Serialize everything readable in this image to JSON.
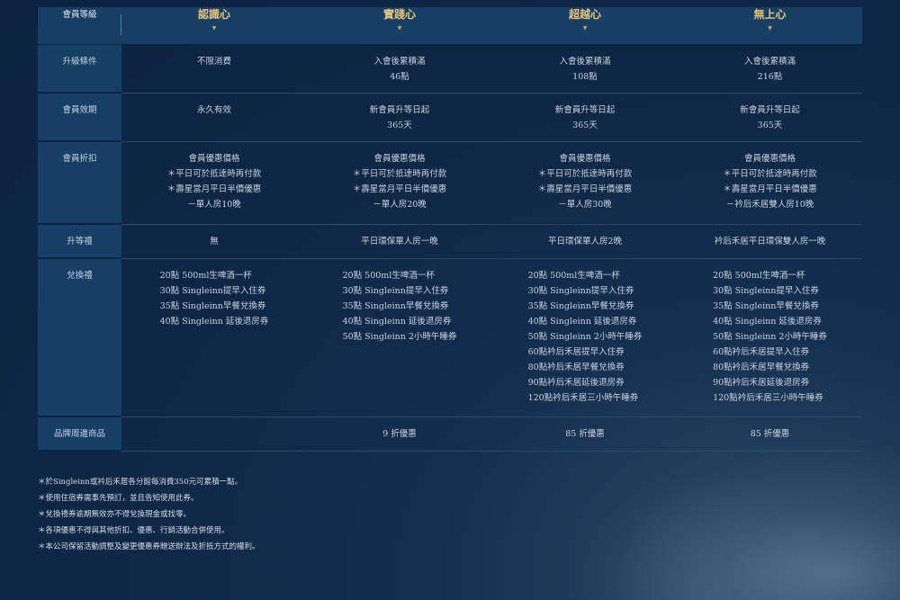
{
  "header": {
    "label": "會員等級",
    "tiers": [
      "認識心",
      "實踐心",
      "超越心",
      "無上心"
    ]
  },
  "rows": {
    "upgrade": {
      "label": "升級條件",
      "cells": [
        [
          "",
          "不限消費"
        ],
        [
          "入會後累積滿",
          "46點"
        ],
        [
          "入會後累積滿",
          "108點"
        ],
        [
          "入會後累積滿",
          "216點"
        ]
      ]
    },
    "validity": {
      "label": "會員效期",
      "cells": [
        [
          "永久有效"
        ],
        [
          "新會員升等日起",
          "365天"
        ],
        [
          "新會員升等日起",
          "365天"
        ],
        [
          "新會員升等日起",
          "365天"
        ]
      ]
    },
    "discount": {
      "label": "會員折扣",
      "cells": [
        [
          "會員優惠價格",
          "＊平日可於抵達時再付款",
          "＊壽星當月平日半價優惠",
          "－單人房10晚"
        ],
        [
          "會員優惠價格",
          "＊平日可於抵達時再付款",
          "＊壽星當月平日半價優惠",
          "－單人房20晚"
        ],
        [
          "會員優惠價格",
          "＊平日可於抵達時再付款",
          "＊壽星當月平日半價優惠",
          "－單人房30晚"
        ],
        [
          "會員優惠價格",
          "＊平日可於抵達時再付款",
          "＊壽星當月平日半價優惠",
          "－衿后禾居雙人房10晚"
        ]
      ]
    },
    "gift": {
      "label": "升等禮",
      "cells": [
        "無",
        "平日環保單人房一晚",
        "平日環保單人房2晚",
        "衿后禾居平日環保雙人房一晚"
      ]
    },
    "exchange": {
      "label": "兌換禮",
      "cells": [
        [
          "20點 500ml生啤酒一杯",
          "30點 Singleinn提早入住券",
          "35點 Singleinn早餐兌換券",
          "40點 Singleinn 延後退房券"
        ],
        [
          "20點 500ml生啤酒一杯",
          "30點 Singleinn提早入住券",
          "35點 Singleinn早餐兌換券",
          "40點 Singleinn 延後退房券",
          "50點 Singleinn 2小時午睡券"
        ],
        [
          "20點 500ml生啤酒一杯",
          "30點 Singleinn提早入住券",
          "35點 Singleinn早餐兌換券",
          "40點 Singleinn 延後退房券",
          "50點 Singleinn 2小時午睡券",
          "60點衿后禾居提早入住券",
          "80點衿后禾居早餐兌換券",
          "90點衿后禾居延後退房券",
          "120點衿后禾居三小時午睡券"
        ],
        [
          "20點 500ml生啤酒一杯",
          "30點 Singleinn提早入住券",
          "35點 Singleinn早餐兌換券",
          "40點 Singleinn 延後退房券",
          "50點 Singleinn 2小時午睡券",
          "60點衿后禾居提早入住券",
          "80點衿后禾居早餐兌換券",
          "90點衿后禾居延後退房券",
          "120點衿后禾居三小時午睡券"
        ]
      ]
    },
    "brand": {
      "label": "品牌周邊商品",
      "cells": [
        "",
        "9 折優惠",
        "85 折優惠",
        "85 折優惠"
      ]
    }
  },
  "notes": [
    "＊於Singleinn或衿后禾居各分館每消費350元可累積一點。",
    "＊使用住宿券需事先預訂，並且告知使用此券。",
    "＊兌換禮券逾期無效亦不得兌換現金或找零。",
    "＊各項優惠不得與其他折扣、優惠、行銷活動合併使用。",
    "＊本公司保留活動調整及變更優惠券贈送辦法及折抵方式的權利。"
  ]
}
